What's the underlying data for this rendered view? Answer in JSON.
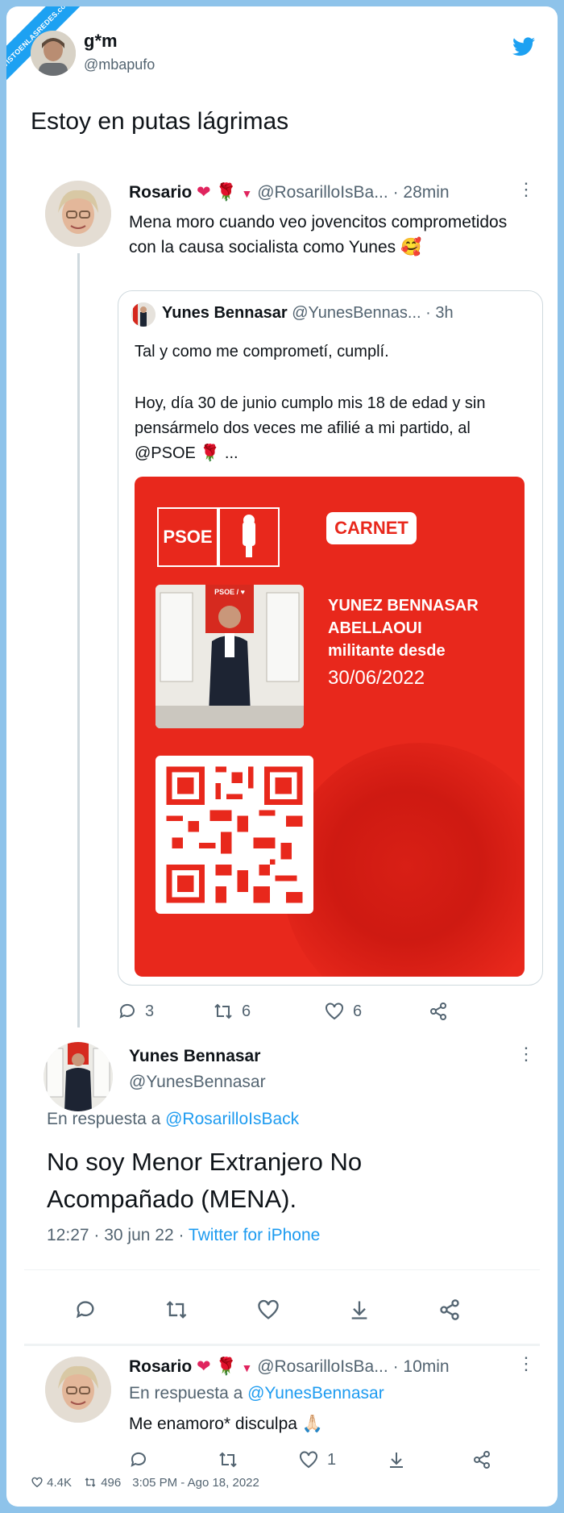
{
  "watermark": "VISTOENLASREDES.com",
  "author": {
    "name": "g*m",
    "handle": "@mbapufo"
  },
  "tweet_text": "Estoy en putas lágrimas",
  "thread": {
    "t1": {
      "name": "Rosario",
      "handle": "@RosarilloIsBa...",
      "time": "· 28min",
      "text": "Mena moro cuando veo jovencitos comprometidos con la causa socialista como Yunes 🥰",
      "quote": {
        "name": "Yunes Bennasar",
        "handle": "@YunesBennas...",
        "time": "· 3h",
        "line1": "Tal y como me comprometí, cumplí.",
        "line2": "Hoy, día 30 de junio cumplo mis 18 de edad y sin pensármelo dos veces me afilié a mi partido, al @PSOE 🌹 ...",
        "card": {
          "psoe": "PSOE",
          "carnet": "CARNET",
          "photo_label": "PSOE / ♥",
          "member_name1": "YUNEZ BENNASAR",
          "member_name2": "ABELLAOUI",
          "member_since": "militante desde",
          "member_date": "30/06/2022"
        }
      },
      "replies": "3",
      "retweets": "6",
      "likes": "6"
    },
    "t2": {
      "name": "Yunes Bennasar",
      "handle": "@YunesBennasar",
      "reply_to_label": "En respuesta a",
      "reply_to": "@RosarilloIsBack",
      "text": "No soy Menor Extranjero No Acompañado (MENA).",
      "time": "12:27 · 30 jun 22 ·",
      "source": "Twitter for iPhone"
    },
    "t3": {
      "name": "Rosario",
      "handle": "@RosarilloIsBa...",
      "time": "· 10min",
      "reply_to_label": "En respuesta a",
      "reply_to": "@YunesBennasar",
      "text": "Me enamoro* disculpa 🙏🏻",
      "likes": "1"
    }
  },
  "footer": {
    "likes": "4.4K",
    "retweets": "496",
    "timestamp": "3:05 PM - Ago 18, 2022"
  },
  "colors": {
    "twitter_blue": "#1d9bf0",
    "psoe_red": "#e8281c",
    "muted": "#536471"
  },
  "icons": [
    "twitter-icon",
    "reply-icon",
    "retweet-icon",
    "like-icon",
    "share-icon",
    "download-icon",
    "more-icon"
  ]
}
